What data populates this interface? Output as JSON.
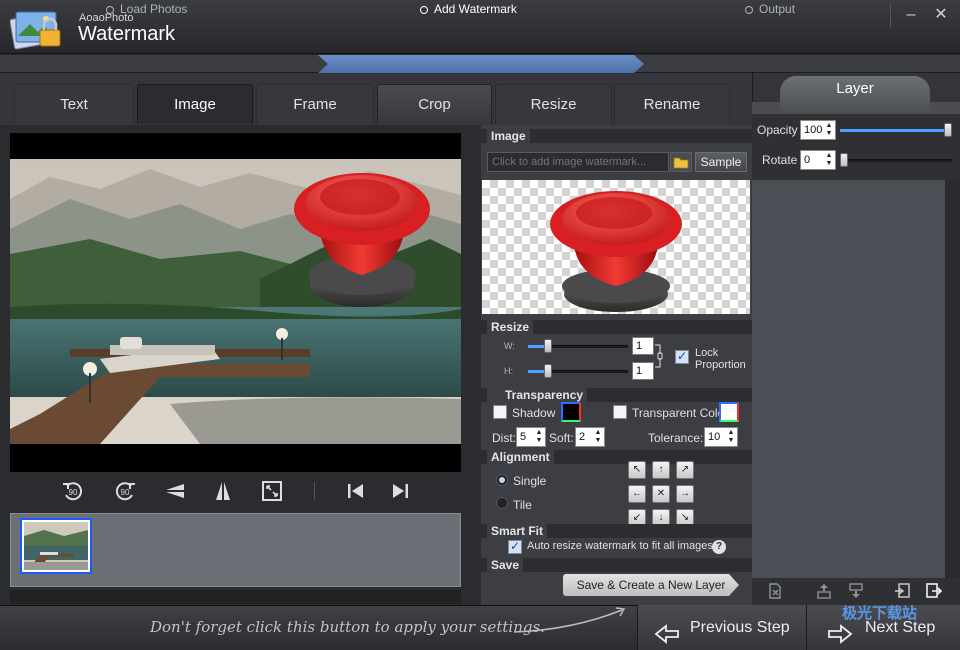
{
  "app": {
    "subtitle": "AoaoPhoto",
    "title": "Watermark"
  },
  "window": {
    "minimize": "–",
    "close": "✕"
  },
  "steps": [
    {
      "label": "Load Photos",
      "active": false
    },
    {
      "label": "Add Watermark",
      "active": true
    },
    {
      "label": "Output",
      "active": false
    }
  ],
  "tabs": [
    {
      "label": "Text"
    },
    {
      "label": "Image",
      "active": true
    },
    {
      "label": "Frame"
    },
    {
      "label": "Crop"
    },
    {
      "label": "Resize"
    },
    {
      "label": "Rename"
    }
  ],
  "image_section": {
    "title": "Image",
    "placeholder": "Click to add image watermark...",
    "sample_label": "Sample"
  },
  "resize_section": {
    "title": "Resize",
    "w_label": "W:",
    "h_label": "H:",
    "w_value": "1",
    "h_value": "1",
    "lock_label_1": "Lock",
    "lock_label_2": "Proportion",
    "lock_checked": true
  },
  "transparency_section": {
    "title": "Transparency",
    "shadow_label": "Shadow",
    "transparent_color_label": "Transparent Color",
    "dist_label": "Dist:",
    "dist_value": "5",
    "soft_label": "Soft:",
    "soft_value": "2",
    "tolerance_label": "Tolerance:",
    "tolerance_value": "10"
  },
  "alignment_section": {
    "title": "Alignment",
    "single_label": "Single",
    "tile_label": "Tile",
    "selected": "Single"
  },
  "smart_fit_section": {
    "title": "Smart Fit",
    "auto_resize_label": "Auto resize watermark to fit all images.",
    "checked": true,
    "help": "?"
  },
  "save_section": {
    "title": "Save",
    "button_label": "Save & Create a New Layer"
  },
  "layer": {
    "title": "Layer",
    "opacity_label": "Opacity",
    "opacity_value": "100",
    "rotate_label": "Rotate",
    "rotate_value": "0"
  },
  "bottom": {
    "hint": "Don't forget click this button to apply your settings.",
    "prev_label": "Previous Step",
    "next_label": "Next Step",
    "site_mark": "极光下载站"
  },
  "colors": {
    "accent": "#4aa3ff",
    "active_step": "#5b7db8",
    "button_red": "#e5302c"
  }
}
